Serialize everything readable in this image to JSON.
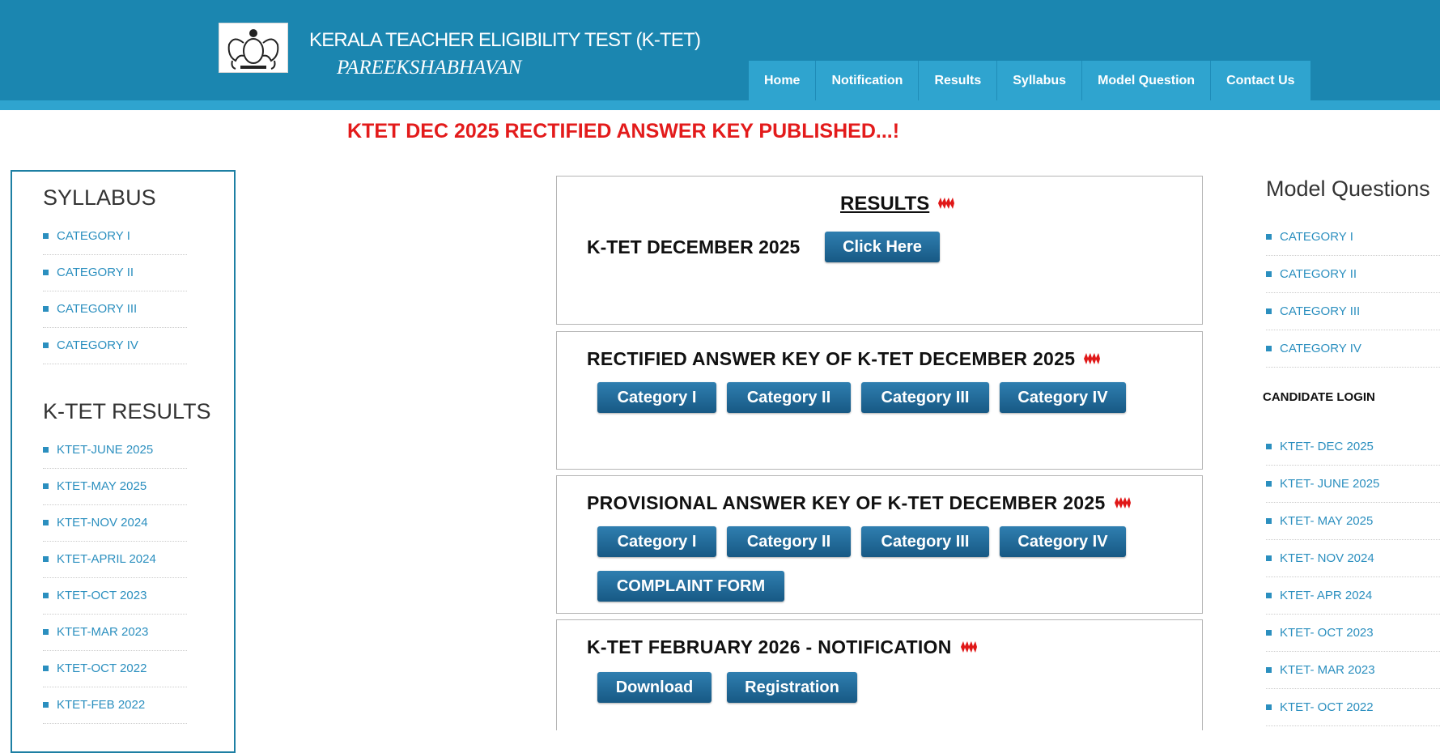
{
  "header": {
    "title": "KERALA TEACHER ELIGIBILITY TEST (K-TET)",
    "subtitle": "PAREEKSHABHAVAN",
    "logo_icon": "kerala-emblem-icon",
    "nav": [
      "Home",
      "Notification",
      "Results",
      "Syllabus",
      "Model Question",
      "Contact Us"
    ]
  },
  "notice": "KTET DEC 2025 RECTIFIED ANSWER KEY PUBLISHED...!",
  "left_sidebar": {
    "syllabus_heading": "SYLLABUS",
    "syllabus_items": [
      "CATEGORY I",
      "CATEGORY II",
      "CATEGORY III",
      "CATEGORY IV"
    ],
    "results_heading": "K-TET RESULTS",
    "results_items": [
      "KTET-JUNE 2025",
      "KTET-MAY 2025",
      "KTET-NOV 2024",
      "KTET-APRIL 2024",
      "KTET-OCT 2023",
      "KTET-MAR 2023",
      "KTET-OCT 2022",
      "KTET-FEB 2022"
    ]
  },
  "panels": {
    "results": {
      "title": "RESULTS",
      "exam_label": "K-TET DECEMBER 2025",
      "button": "Click Here"
    },
    "rectified": {
      "title": "RECTIFIED ANSWER KEY OF K-TET DECEMBER 2025",
      "buttons": [
        "Category I",
        "Category II",
        "Category III",
        "Category IV"
      ]
    },
    "provisional": {
      "title": "PROVISIONAL ANSWER KEY OF K-TET DECEMBER 2025",
      "buttons": [
        "Category I",
        "Category II",
        "Category III",
        "Category IV"
      ],
      "complaint_button": "COMPLAINT FORM"
    },
    "notification": {
      "title": "K-TET FEBRUARY 2026 - NOTIFICATION",
      "buttons": [
        "Download",
        "Registration"
      ]
    }
  },
  "right_sidebar": {
    "model_heading": "Model Questions",
    "model_items": [
      "CATEGORY I",
      "CATEGORY II",
      "CATEGORY III",
      "CATEGORY IV"
    ],
    "candidate_heading": "CANDIDATE LOGIN",
    "candidate_items": [
      "KTET- DEC 2025",
      "KTET- JUNE 2025",
      "KTET- MAY 2025",
      "KTET- NOV 2024",
      "KTET- APR 2024",
      "KTET- OCT 2023",
      "KTET- MAR 2023",
      "KTET- OCT 2022"
    ]
  },
  "colors": {
    "header_bg": "#1b86b0",
    "nav_bg": "#2fa4cf",
    "notice_red": "#e31b1b",
    "link_blue": "#2b8fbf",
    "button_blue": "#1f6a98"
  }
}
